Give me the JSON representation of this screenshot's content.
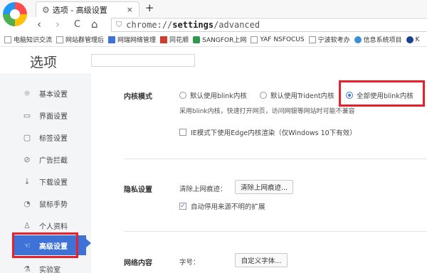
{
  "tab": {
    "icon": "gear-icon",
    "title": "选项 - 高级设置",
    "close": "×",
    "new_tab": "+"
  },
  "nav": {
    "back": "‹",
    "forward": "›",
    "reload": "C",
    "home": "⌂",
    "url_prefix": "chrome://",
    "url_host": "settings",
    "url_path": "/advanced"
  },
  "bookmarks": [
    {
      "icon": "page-icon",
      "label": "电脑知识交流"
    },
    {
      "icon": "page-icon",
      "label": "网站群管理后"
    },
    {
      "icon": "blue-square-icon",
      "label": "网瑞网络管理"
    },
    {
      "icon": "red-square-icon",
      "label": "同花顺"
    },
    {
      "icon": "sangfor-icon",
      "label": "SANGFOR上网"
    },
    {
      "icon": "page-icon",
      "label": "YAF NSFOCUS"
    },
    {
      "icon": "page-icon",
      "label": "宁波软考办"
    },
    {
      "icon": "e-icon",
      "label": "信息系统项目"
    },
    {
      "icon": "globe-icon",
      "label": "K"
    }
  ],
  "page": {
    "title": "选项",
    "search_placeholder": ""
  },
  "sidebar": {
    "items": [
      {
        "icon": "☼",
        "label": "基本设置"
      },
      {
        "icon": "▭",
        "label": "界面设置"
      },
      {
        "icon": "▢",
        "label": "标签设置"
      },
      {
        "icon": "⊘",
        "label": "广告拦截"
      },
      {
        "icon": "↓",
        "label": "下载设置"
      },
      {
        "icon": "◔",
        "label": "鼠标手势"
      },
      {
        "icon": "♙",
        "label": "个人资料"
      },
      {
        "icon": "☜",
        "label": "高级设置"
      },
      {
        "icon": "⚗",
        "label": "实验室"
      }
    ]
  },
  "kernel": {
    "title": "内核模式",
    "options": [
      "默认使用blink内核",
      "默认使用Trident内核",
      "全部使用blink内核"
    ],
    "selected": 2,
    "hint": "采用blink内核，快速打开网页，访问网银等网站时可能不兼容",
    "ie_edge_label": "IE模式下使用Edge内核渲染（仅Windows 10下有效）",
    "ie_edge_checked": false
  },
  "privacy": {
    "title": "隐私设置",
    "clear_label": "清除上网痕迹：",
    "clear_button": "清除上网痕迹...",
    "auto_disable_label": "自动停用来源不明的扩展",
    "auto_disable_checked": true
  },
  "network": {
    "title": "网络内容",
    "font_label": "字号：",
    "font_button": "自定义字体..."
  },
  "colors": {
    "accent": "#3f72d6",
    "highlight": "#e8202a",
    "sidebar_bg": "#f4f5f7"
  }
}
